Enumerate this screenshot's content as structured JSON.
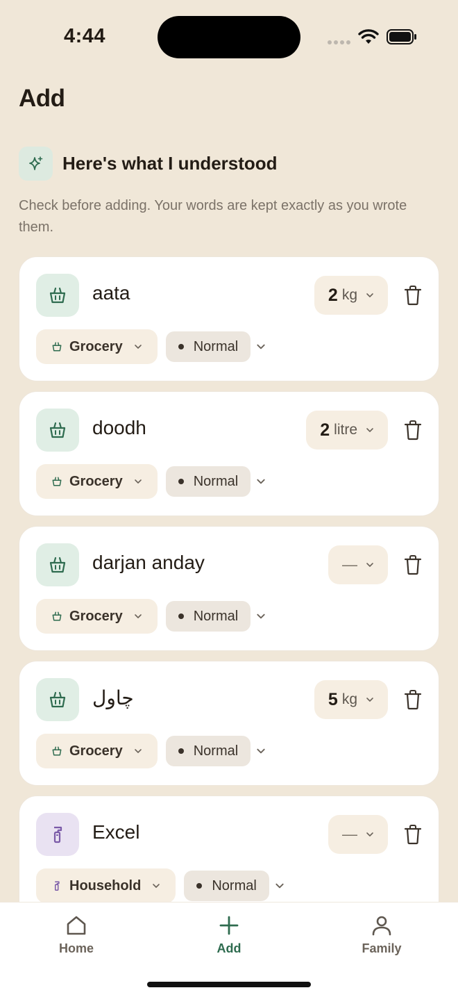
{
  "status_bar": {
    "time": "4:44"
  },
  "page": {
    "title": "Add"
  },
  "banner": {
    "title": "Here's what I understood",
    "subtitle": "Check before adding. Your words are kept exactly as you wrote them."
  },
  "items": [
    {
      "name": "aata",
      "qty": "2",
      "unit": "kg",
      "category": "Grocery",
      "priority": "Normal",
      "icon": "basket-icon"
    },
    {
      "name": "doodh",
      "qty": "2",
      "unit": "litre",
      "category": "Grocery",
      "priority": "Normal",
      "icon": "basket-icon"
    },
    {
      "name": "darjan anday",
      "qty": "",
      "unit": "",
      "placeholder": "—",
      "category": "Grocery",
      "priority": "Normal",
      "icon": "basket-icon"
    },
    {
      "name": "چاول",
      "qty": "5",
      "unit": "kg",
      "category": "Grocery",
      "priority": "Normal",
      "icon": "basket-icon"
    },
    {
      "name": "Excel",
      "qty": "",
      "unit": "",
      "placeholder": "—",
      "category": "Household",
      "priority": "Normal",
      "icon": "spray-bottle-icon"
    }
  ],
  "tabs": [
    {
      "label": "Home",
      "icon": "home-icon"
    },
    {
      "label": "Add",
      "icon": "plus-icon",
      "active": true
    },
    {
      "label": "Family",
      "icon": "person-icon"
    }
  ],
  "colors": {
    "background": "#F0E7D8",
    "accent": "#2E6B4F",
    "grocery_tint": "#E0EEE5",
    "household_tint": "#E9E2F2",
    "household_icon": "#7A5AA8"
  }
}
